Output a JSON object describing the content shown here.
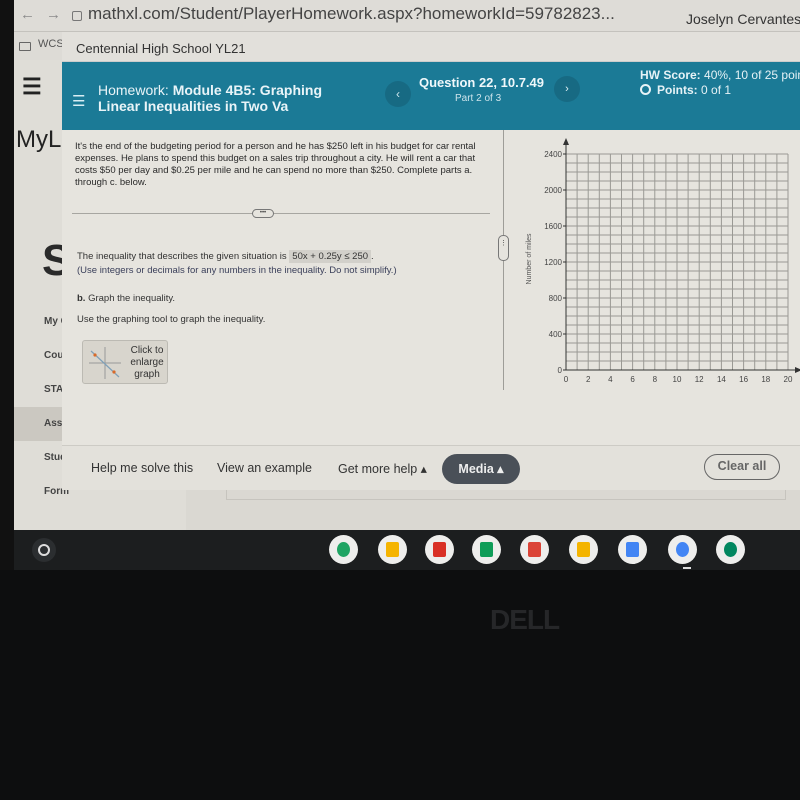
{
  "browser": {
    "back_icon": "arrow-left",
    "forward_icon": "arrow-right",
    "url": "mathxl.com/Student/PlayerHomework.aspx?homeworkId=59782823...",
    "bookmark_folder": "WCS",
    "user_name": "Joselyn Cervantes",
    "user_extra": "0"
  },
  "underlying_page": {
    "logo": "MyL",
    "heading_letter": "S",
    "back_item": "My C",
    "items": [
      {
        "label": "Cour",
        "active": false
      },
      {
        "label": "STAR",
        "active": false
      },
      {
        "label": "Assig",
        "active": true
      },
      {
        "label": "Stud",
        "active": false
      },
      {
        "label": "Form",
        "active": false
      }
    ]
  },
  "homework": {
    "school": "Centennial High School YL21",
    "title_prefix": "Homework:",
    "title_main": "Module 4B5: Graphing Linear Inequalities in Two Va",
    "question_title": "Question 22, 10.7.49",
    "part": "Part 2 of 3",
    "prev_icon": "chevron-left",
    "next_icon": "chevron-right",
    "hw_score_label": "HW Score:",
    "hw_score_value": "40%, 10 of 25 poin",
    "points_label": "Points:",
    "points_value": "0 of 1"
  },
  "problem": {
    "text": "It's the end of the budgeting period for a person and he has $250 left in his budget for car rental expenses. He plans to spend this budget on a sales trip throughout a city. He will rent a car that costs $50 per day and $0.25 per mile and he can spend no more than $250. Complete parts a. through c. below.",
    "expand_label": "•••",
    "inequality_prefix": "The inequality that describes the given situation is",
    "inequality_answer": "50x + 0.25y ≤ 250",
    "inequality_suffix": ".",
    "inequality_note": "(Use integers or decimals for any numbers in the inequality. Do not simplify.)",
    "part_b_label": "b.",
    "part_b_text": "Graph the inequality.",
    "graph_instruction": "Use the graphing tool to graph the inequality.",
    "enlarge_label": "Click to enlarge graph"
  },
  "graph": {
    "ylabel": "Number of miles",
    "xlabel": "",
    "x_range": [
      0,
      20
    ],
    "y_range": [
      0,
      2400
    ],
    "x_ticks": [
      0,
      2,
      4,
      6,
      8,
      10,
      12,
      14,
      16,
      18,
      20
    ],
    "y_ticks": [
      0,
      400,
      800,
      1200,
      1600,
      2000,
      2400
    ],
    "x_grid_step": 1,
    "y_grid_step": 100,
    "grid": true
  },
  "footer": {
    "help_solve": "Help me solve this",
    "view_example": "View an example",
    "more_help": "Get more help ▴",
    "media": "Media ▴",
    "clear_all": "Clear all"
  },
  "shelf": {
    "apps": [
      {
        "name": "google-drive",
        "color": "#1fa463"
      },
      {
        "name": "google-keep",
        "color": "#f5b400"
      },
      {
        "name": "gmail",
        "color": "#d93025"
      },
      {
        "name": "google-sheets",
        "color": "#0f9d58"
      },
      {
        "name": "google-drawings",
        "color": "#db4437"
      },
      {
        "name": "google-slides",
        "color": "#f4b400"
      },
      {
        "name": "google-docs",
        "color": "#4285f4"
      },
      {
        "name": "chrome",
        "color": "#4285f4"
      },
      {
        "name": "play-store",
        "color": "#01875f"
      }
    ]
  },
  "hardware": {
    "brand": "DELL"
  },
  "colors": {
    "header_teal": "#1b7a96",
    "media_button": "#4a5058"
  }
}
